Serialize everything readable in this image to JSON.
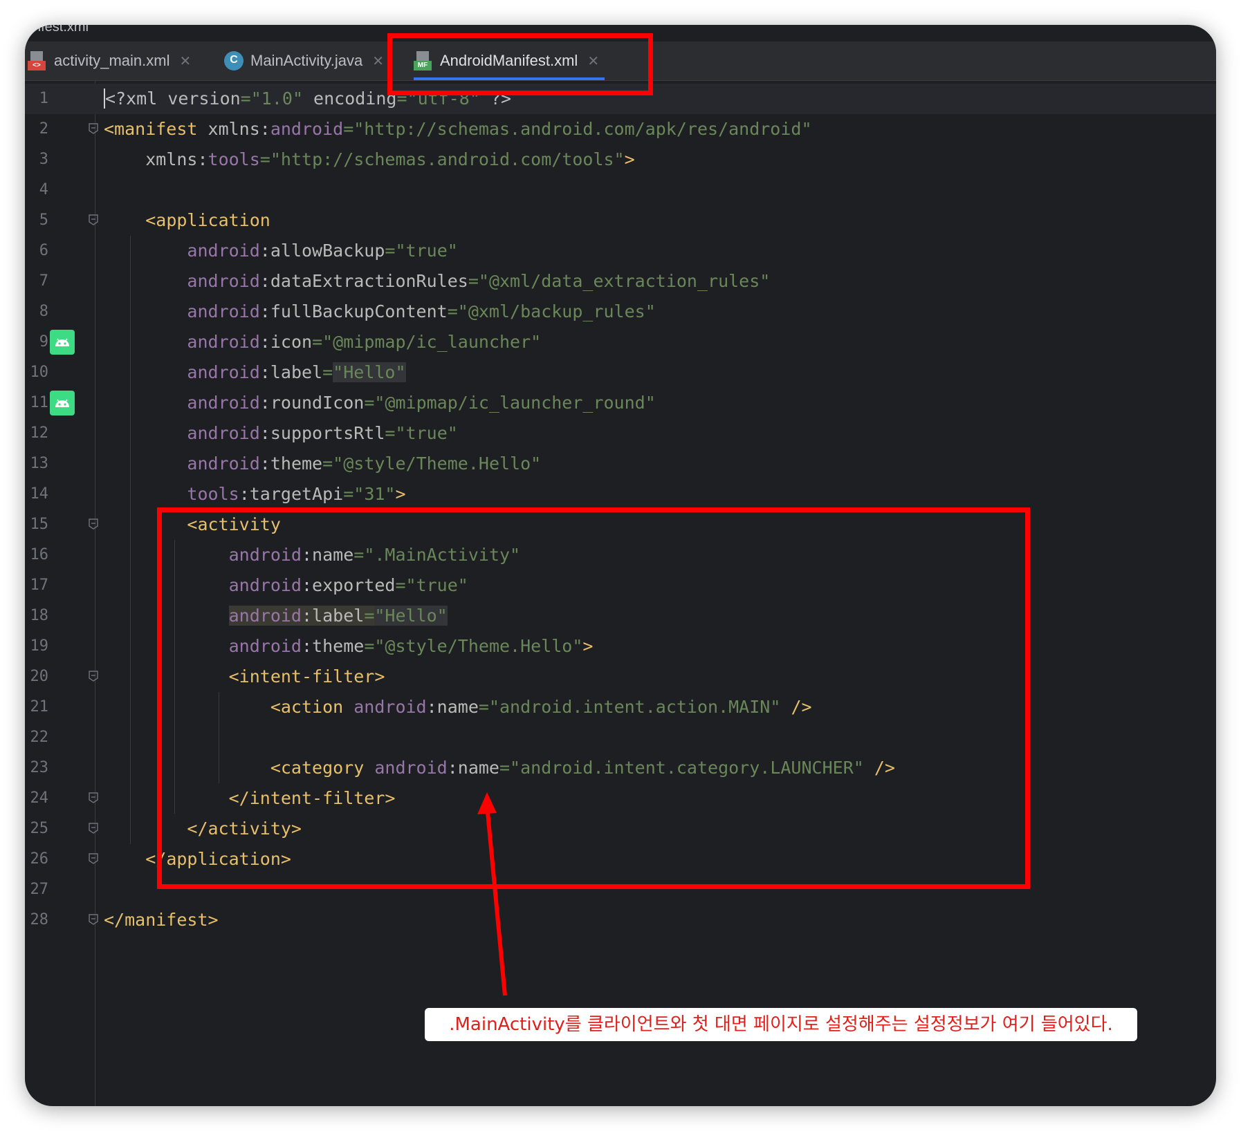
{
  "window": {
    "title_fragment": "nfest.xml"
  },
  "tabs": [
    {
      "label": "activity_main.xml",
      "icon": "xml-file-icon",
      "active": false
    },
    {
      "label": "MainActivity.java",
      "icon": "java-class-icon",
      "active": false
    },
    {
      "label": "AndroidManifest.xml",
      "icon": "manifest-file-icon",
      "active": true
    }
  ],
  "editor": {
    "lines": [
      {
        "n": "1",
        "tokens": [
          [
            "caret",
            ""
          ],
          [
            "punct",
            "<?xml "
          ],
          [
            "attr",
            "version"
          ],
          [
            "eq",
            "="
          ],
          [
            "val",
            "\"1.0\""
          ],
          [
            "attr",
            " encoding"
          ],
          [
            "eq",
            "="
          ],
          [
            "val",
            "\"utf-8\""
          ],
          [
            "punct",
            " ?>"
          ]
        ]
      },
      {
        "n": "2",
        "tokens": [
          [
            "tag",
            "<manifest "
          ],
          [
            "attr",
            "xmlns:"
          ],
          [
            "ns",
            "android"
          ],
          [
            "eq",
            "="
          ],
          [
            "val",
            "\"http://schemas.android.com/apk/res/android\""
          ]
        ]
      },
      {
        "n": "3",
        "tokens": [
          [
            "punct",
            "    "
          ],
          [
            "attr",
            "xmlns:"
          ],
          [
            "ns",
            "tools"
          ],
          [
            "eq",
            "="
          ],
          [
            "val",
            "\"http://schemas.android.com/tools\""
          ],
          [
            "tag",
            ">"
          ]
        ]
      },
      {
        "n": "4",
        "tokens": []
      },
      {
        "n": "5",
        "tokens": [
          [
            "punct",
            "    "
          ],
          [
            "tag",
            "<application"
          ]
        ]
      },
      {
        "n": "6",
        "tokens": [
          [
            "punct",
            "        "
          ],
          [
            "ns",
            "android"
          ],
          [
            "punct",
            ":"
          ],
          [
            "attr",
            "allowBackup"
          ],
          [
            "eq",
            "="
          ],
          [
            "val",
            "\"true\""
          ]
        ]
      },
      {
        "n": "7",
        "tokens": [
          [
            "punct",
            "        "
          ],
          [
            "ns",
            "android"
          ],
          [
            "punct",
            ":"
          ],
          [
            "attr",
            "dataExtractionRules"
          ],
          [
            "eq",
            "="
          ],
          [
            "val",
            "\"@xml/data_extraction_rules\""
          ]
        ]
      },
      {
        "n": "8",
        "tokens": [
          [
            "punct",
            "        "
          ],
          [
            "ns",
            "android"
          ],
          [
            "punct",
            ":"
          ],
          [
            "attr",
            "fullBackupContent"
          ],
          [
            "eq",
            "="
          ],
          [
            "val",
            "\"@xml/backup_rules\""
          ]
        ]
      },
      {
        "n": "9",
        "tokens": [
          [
            "punct",
            "        "
          ],
          [
            "ns",
            "android"
          ],
          [
            "punct",
            ":"
          ],
          [
            "attr",
            "icon"
          ],
          [
            "eq",
            "="
          ],
          [
            "val",
            "\"@mipmap/ic_launcher\""
          ]
        ]
      },
      {
        "n": "10",
        "tokens": [
          [
            "punct",
            "        "
          ],
          [
            "ns",
            "android"
          ],
          [
            "punct",
            ":"
          ],
          [
            "attr",
            "label"
          ],
          [
            "eq",
            "="
          ],
          [
            "hlval",
            "\"Hello\""
          ]
        ]
      },
      {
        "n": "11",
        "tokens": [
          [
            "punct",
            "        "
          ],
          [
            "ns",
            "android"
          ],
          [
            "punct",
            ":"
          ],
          [
            "attr",
            "roundIcon"
          ],
          [
            "eq",
            "="
          ],
          [
            "val",
            "\"@mipmap/ic_launcher_round\""
          ]
        ]
      },
      {
        "n": "12",
        "tokens": [
          [
            "punct",
            "        "
          ],
          [
            "ns",
            "android"
          ],
          [
            "punct",
            ":"
          ],
          [
            "attr",
            "supportsRtl"
          ],
          [
            "eq",
            "="
          ],
          [
            "val",
            "\"true\""
          ]
        ]
      },
      {
        "n": "13",
        "tokens": [
          [
            "punct",
            "        "
          ],
          [
            "ns",
            "android"
          ],
          [
            "punct",
            ":"
          ],
          [
            "attr",
            "theme"
          ],
          [
            "eq",
            "="
          ],
          [
            "val",
            "\"@style/Theme.Hello\""
          ]
        ]
      },
      {
        "n": "14",
        "tokens": [
          [
            "punct",
            "        "
          ],
          [
            "ns",
            "tools"
          ],
          [
            "punct",
            ":"
          ],
          [
            "attr",
            "targetApi"
          ],
          [
            "eq",
            "="
          ],
          [
            "val",
            "\"31\""
          ],
          [
            "tag",
            ">"
          ]
        ]
      },
      {
        "n": "15",
        "tokens": [
          [
            "punct",
            "        "
          ],
          [
            "tag",
            "<activity"
          ]
        ]
      },
      {
        "n": "16",
        "tokens": [
          [
            "punct",
            "            "
          ],
          [
            "ns",
            "android"
          ],
          [
            "punct",
            ":"
          ],
          [
            "attr",
            "name"
          ],
          [
            "eq",
            "="
          ],
          [
            "val",
            "\".MainActivity\""
          ]
        ]
      },
      {
        "n": "17",
        "tokens": [
          [
            "punct",
            "            "
          ],
          [
            "ns",
            "android"
          ],
          [
            "punct",
            ":"
          ],
          [
            "attr",
            "exported"
          ],
          [
            "eq",
            "="
          ],
          [
            "val",
            "\"true\""
          ]
        ]
      },
      {
        "n": "18",
        "tokens": [
          [
            "punct",
            "            "
          ],
          [
            "hlns",
            "android"
          ],
          [
            "hlpunct",
            ":"
          ],
          [
            "hlattr",
            "label"
          ],
          [
            "hleq",
            "="
          ],
          [
            "hlval",
            "\"Hello\""
          ]
        ]
      },
      {
        "n": "19",
        "tokens": [
          [
            "punct",
            "            "
          ],
          [
            "ns",
            "android"
          ],
          [
            "punct",
            ":"
          ],
          [
            "attr",
            "theme"
          ],
          [
            "eq",
            "="
          ],
          [
            "val",
            "\"@style/Theme.Hello\""
          ],
          [
            "tag",
            ">"
          ]
        ]
      },
      {
        "n": "20",
        "tokens": [
          [
            "punct",
            "            "
          ],
          [
            "tag",
            "<intent-filter>"
          ]
        ]
      },
      {
        "n": "21",
        "tokens": [
          [
            "punct",
            "                "
          ],
          [
            "tag",
            "<action "
          ],
          [
            "ns",
            "android"
          ],
          [
            "punct",
            ":"
          ],
          [
            "attr",
            "name"
          ],
          [
            "eq",
            "="
          ],
          [
            "val",
            "\"android.intent.action.MAIN\""
          ],
          [
            "tag",
            " />"
          ]
        ]
      },
      {
        "n": "22",
        "tokens": []
      },
      {
        "n": "23",
        "tokens": [
          [
            "punct",
            "                "
          ],
          [
            "tag",
            "<category "
          ],
          [
            "ns",
            "android"
          ],
          [
            "punct",
            ":"
          ],
          [
            "attr",
            "name"
          ],
          [
            "eq",
            "="
          ],
          [
            "val",
            "\"android.intent.category.LAUNCHER\""
          ],
          [
            "tag",
            " />"
          ]
        ]
      },
      {
        "n": "24",
        "tokens": [
          [
            "punct",
            "            "
          ],
          [
            "tag",
            "</intent-filter>"
          ]
        ]
      },
      {
        "n": "25",
        "tokens": [
          [
            "punct",
            "        "
          ],
          [
            "tag",
            "</activity>"
          ]
        ]
      },
      {
        "n": "26",
        "tokens": [
          [
            "punct",
            "    "
          ],
          [
            "tag",
            "</application>"
          ]
        ]
      },
      {
        "n": "27",
        "tokens": []
      },
      {
        "n": "28",
        "tokens": [
          [
            "tag",
            "</manifest>"
          ]
        ]
      }
    ],
    "fold_markers": [
      "2",
      "5",
      "15",
      "20",
      "24",
      "25",
      "26",
      "28"
    ],
    "android_gutter_icons": [
      "9",
      "11"
    ]
  },
  "annotation": {
    "text": ".MainActivity를 클라이언트와 첫 대면 페이지로 설정해주는 설정정보가 여기 들어있다."
  },
  "colors": {
    "highlight": "#ff0000",
    "background": "#1e1f22",
    "tag": "#e8bf6a",
    "namespace": "#9876aa",
    "string": "#6a8759"
  }
}
